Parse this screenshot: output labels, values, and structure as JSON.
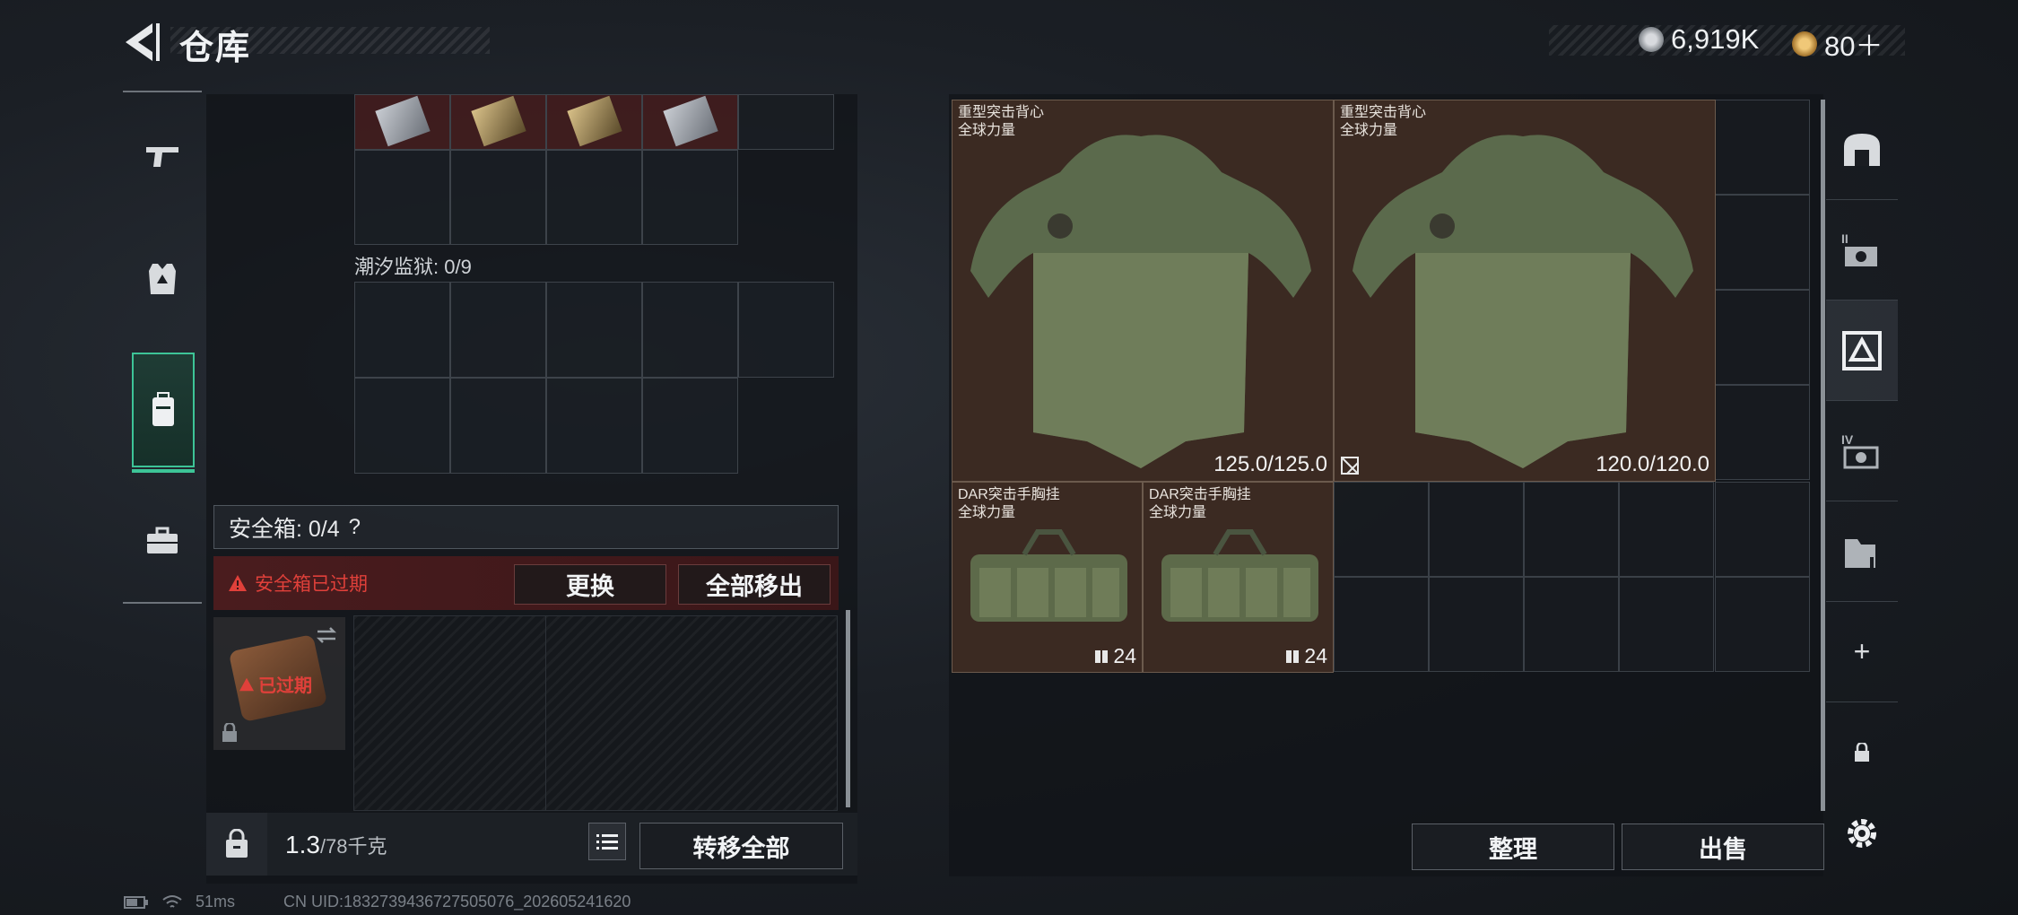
{
  "header": {
    "title": "仓库",
    "currency": [
      {
        "icon": "silver-coin-icon",
        "value": "6,919K"
      },
      {
        "icon": "gold-coin-icon",
        "value": "80＋"
      }
    ]
  },
  "left_tabs": [
    {
      "name": "weapon",
      "icon": "pistol-icon"
    },
    {
      "name": "armor",
      "icon": "armor-vest-icon"
    },
    {
      "name": "backpack",
      "icon": "backpack-icon",
      "active": true
    },
    {
      "name": "case",
      "icon": "briefcase-icon"
    }
  ],
  "left_panel": {
    "section_label": "潮汐监狱: 0/9",
    "safe_box_label": "安全箱: 0/4",
    "help_symbol": "?",
    "expired_warning": "安全箱已过期",
    "replace_button": "更换",
    "remove_all_button": "全部移出",
    "case_status": "已过期",
    "weight_current": "1.3",
    "weight_max": "/78千克",
    "transfer_all_button": "转移全部"
  },
  "stash": {
    "items": [
      {
        "name": "重型突击背心",
        "faction": "全球力量",
        "durability": "125.0/125.0",
        "type": "vest"
      },
      {
        "name": "重型突击背心",
        "faction": "全球力量",
        "durability": "120.0/120.0",
        "type": "vest"
      },
      {
        "name": "DAR突击手胸挂",
        "faction": "全球力量",
        "stack": "24",
        "type": "rig"
      },
      {
        "name": "DAR突击手胸挂",
        "faction": "全球力量",
        "stack": "24",
        "type": "rig"
      }
    ],
    "organize_button": "整理",
    "sell_button": "出售"
  },
  "right_tabs": [
    {
      "label": "",
      "icon": "stash-home-icon"
    },
    {
      "label": "II",
      "icon": "stash-page-2-icon"
    },
    {
      "label": "",
      "icon": "stash-page-3-icon",
      "active": true
    },
    {
      "label": "IV",
      "icon": "stash-page-4-icon"
    },
    {
      "label": "",
      "icon": "stash-page-5-icon"
    },
    {
      "label": "+",
      "icon": "add-page-icon"
    },
    {
      "label": "",
      "icon": "lock-icon"
    }
  ],
  "status": {
    "ping": "51ms",
    "uid": "CN UID:1832739436727505076_202605241620"
  },
  "colors": {
    "accent": "#3dc497",
    "warning": "#e0403a",
    "item_bg": "#3b2a22"
  }
}
